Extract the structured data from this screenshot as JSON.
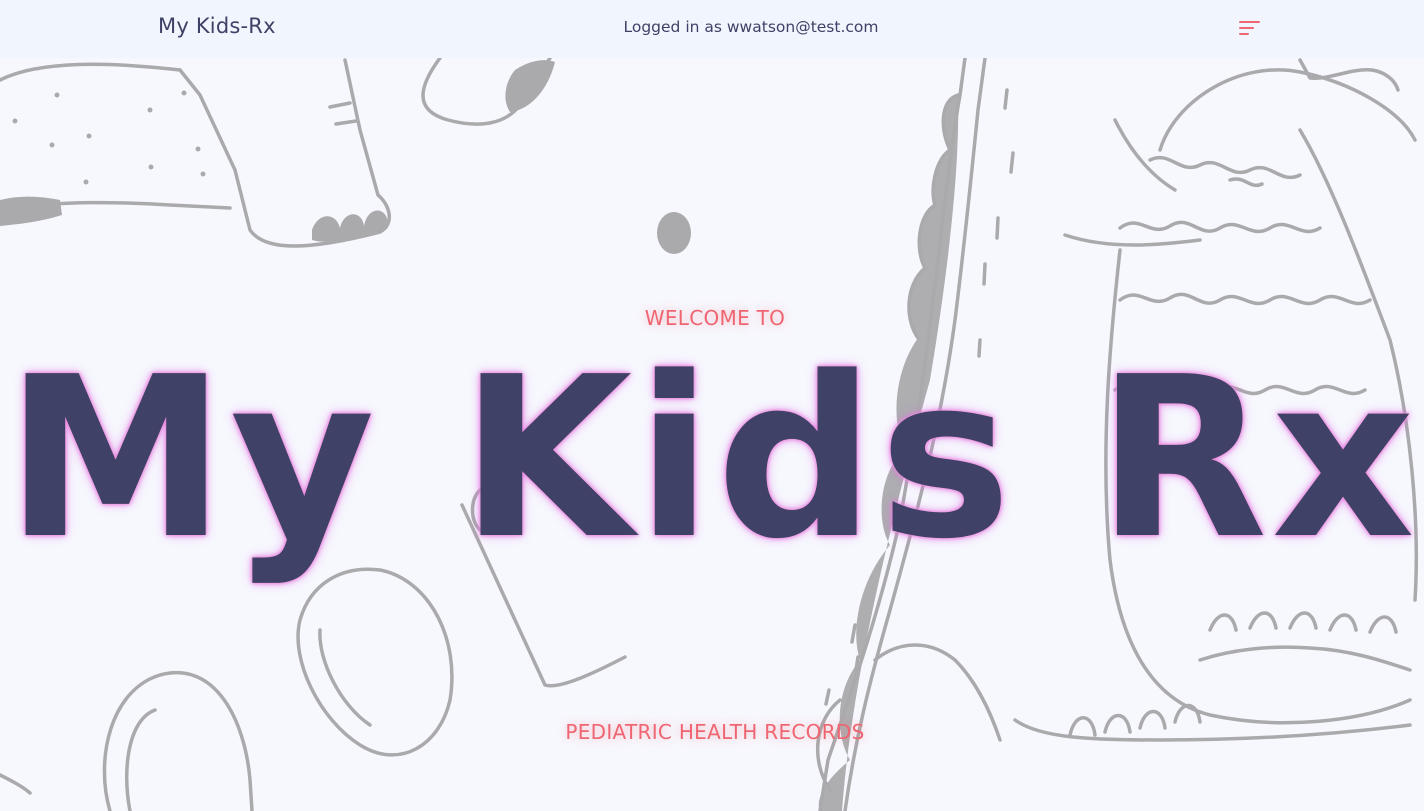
{
  "navbar": {
    "brand": "My Kids-Rx",
    "user_status": "Logged in as wwatson@test.com",
    "menu_icon": "menu-lines-icon"
  },
  "hero": {
    "kicker": "WELCOME TO",
    "title": "My Kids Rx",
    "subtitle": "PEDIATRIC HEALTH RECORDS"
  },
  "background": {
    "art": "dinosaur-doodle-illustration",
    "line_color": "#aaaaad"
  },
  "colors": {
    "page_bg": "#f7f8fe",
    "navbar_bg": "#f1f5fd",
    "navy": "#3f4166",
    "accent": "#ef6571",
    "glow": "#e57ce3"
  }
}
